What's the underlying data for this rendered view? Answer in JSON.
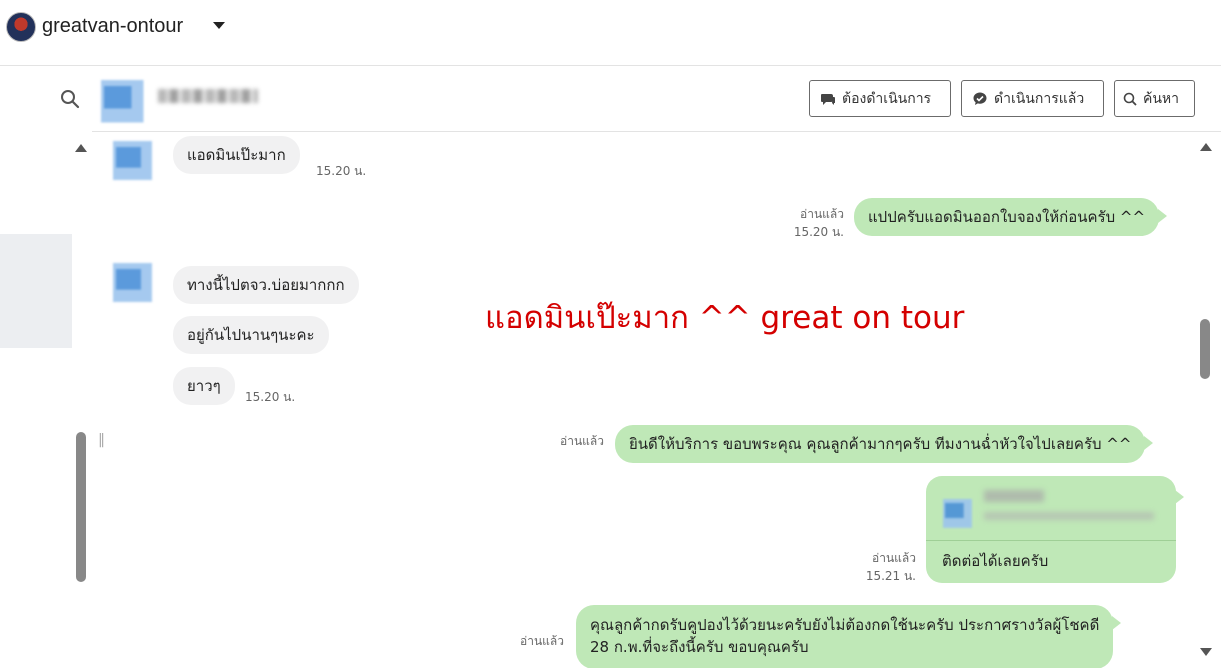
{
  "account": {
    "name": "greatvan-ontour"
  },
  "header_buttons": {
    "todo": "ต้องดำเนินการ",
    "done": "ดำเนินการแล้ว",
    "search": "ค้นหา"
  },
  "overlay_text": "แอดมินเป๊ะมาก ^^ great on tour",
  "messages": [
    {
      "dir": "in",
      "text": "แอดมินเป๊ะมาก",
      "time": "15.20 น."
    },
    {
      "dir": "out",
      "text": "แปปครับแอดมินออกใบจองให้ก่อนครับ ^^",
      "read": "อ่านแล้ว",
      "time": "15.20 น."
    },
    {
      "dir": "in",
      "text": "ทางนี้ไปตจว.บ่อยมากกก"
    },
    {
      "dir": "in",
      "text": "อยู่กันไปนานๆนะคะ"
    },
    {
      "dir": "in",
      "text": "ยาวๆ",
      "time": "15.20 น."
    },
    {
      "dir": "out",
      "text": "ยินดีให้บริการ ขอบพระคุณ คุณลูกค้ามากๆครับ ทีมงานฉ่ำหัวใจไปเลยครับ ^^",
      "read": "อ่านแล้ว"
    },
    {
      "dir": "out",
      "text": "ติดต่อได้เลยครับ",
      "read": "อ่านแล้ว",
      "time": "15.21 น."
    },
    {
      "dir": "out",
      "line1": "คุณลูกค้ากดรับคูปองไว้ด้วยนะครับยังไม่ต้องกดใช้นะครับ ประกาศรางวัลผู้โชคดี",
      "line2": "28 ก.พ.ที่จะถึงนี้ครับ ขอบคุณครับ",
      "read": "อ่านแล้ว"
    }
  ],
  "icons": {
    "search": "search-icon",
    "chat": "chat-bubble-icon",
    "chat_check": "chat-check-icon",
    "caret": "caret-down-icon"
  }
}
